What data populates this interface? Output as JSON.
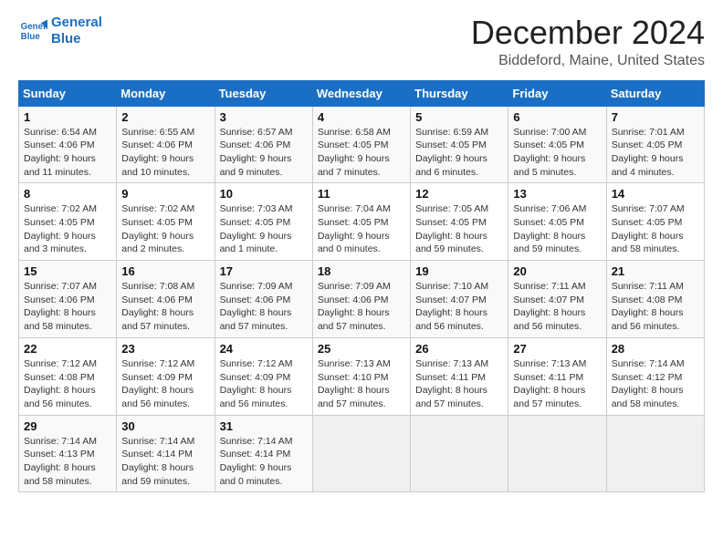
{
  "header": {
    "logo_line1": "General",
    "logo_line2": "Blue",
    "month": "December 2024",
    "location": "Biddeford, Maine, United States"
  },
  "weekdays": [
    "Sunday",
    "Monday",
    "Tuesday",
    "Wednesday",
    "Thursday",
    "Friday",
    "Saturday"
  ],
  "weeks": [
    [
      {
        "day": 1,
        "info": "Sunrise: 6:54 AM\nSunset: 4:06 PM\nDaylight: 9 hours\nand 11 minutes."
      },
      {
        "day": 2,
        "info": "Sunrise: 6:55 AM\nSunset: 4:06 PM\nDaylight: 9 hours\nand 10 minutes."
      },
      {
        "day": 3,
        "info": "Sunrise: 6:57 AM\nSunset: 4:06 PM\nDaylight: 9 hours\nand 9 minutes."
      },
      {
        "day": 4,
        "info": "Sunrise: 6:58 AM\nSunset: 4:05 PM\nDaylight: 9 hours\nand 7 minutes."
      },
      {
        "day": 5,
        "info": "Sunrise: 6:59 AM\nSunset: 4:05 PM\nDaylight: 9 hours\nand 6 minutes."
      },
      {
        "day": 6,
        "info": "Sunrise: 7:00 AM\nSunset: 4:05 PM\nDaylight: 9 hours\nand 5 minutes."
      },
      {
        "day": 7,
        "info": "Sunrise: 7:01 AM\nSunset: 4:05 PM\nDaylight: 9 hours\nand 4 minutes."
      }
    ],
    [
      {
        "day": 8,
        "info": "Sunrise: 7:02 AM\nSunset: 4:05 PM\nDaylight: 9 hours\nand 3 minutes."
      },
      {
        "day": 9,
        "info": "Sunrise: 7:02 AM\nSunset: 4:05 PM\nDaylight: 9 hours\nand 2 minutes."
      },
      {
        "day": 10,
        "info": "Sunrise: 7:03 AM\nSunset: 4:05 PM\nDaylight: 9 hours\nand 1 minute."
      },
      {
        "day": 11,
        "info": "Sunrise: 7:04 AM\nSunset: 4:05 PM\nDaylight: 9 hours\nand 0 minutes."
      },
      {
        "day": 12,
        "info": "Sunrise: 7:05 AM\nSunset: 4:05 PM\nDaylight: 8 hours\nand 59 minutes."
      },
      {
        "day": 13,
        "info": "Sunrise: 7:06 AM\nSunset: 4:05 PM\nDaylight: 8 hours\nand 59 minutes."
      },
      {
        "day": 14,
        "info": "Sunrise: 7:07 AM\nSunset: 4:05 PM\nDaylight: 8 hours\nand 58 minutes."
      }
    ],
    [
      {
        "day": 15,
        "info": "Sunrise: 7:07 AM\nSunset: 4:06 PM\nDaylight: 8 hours\nand 58 minutes."
      },
      {
        "day": 16,
        "info": "Sunrise: 7:08 AM\nSunset: 4:06 PM\nDaylight: 8 hours\nand 57 minutes."
      },
      {
        "day": 17,
        "info": "Sunrise: 7:09 AM\nSunset: 4:06 PM\nDaylight: 8 hours\nand 57 minutes."
      },
      {
        "day": 18,
        "info": "Sunrise: 7:09 AM\nSunset: 4:06 PM\nDaylight: 8 hours\nand 57 minutes."
      },
      {
        "day": 19,
        "info": "Sunrise: 7:10 AM\nSunset: 4:07 PM\nDaylight: 8 hours\nand 56 minutes."
      },
      {
        "day": 20,
        "info": "Sunrise: 7:11 AM\nSunset: 4:07 PM\nDaylight: 8 hours\nand 56 minutes."
      },
      {
        "day": 21,
        "info": "Sunrise: 7:11 AM\nSunset: 4:08 PM\nDaylight: 8 hours\nand 56 minutes."
      }
    ],
    [
      {
        "day": 22,
        "info": "Sunrise: 7:12 AM\nSunset: 4:08 PM\nDaylight: 8 hours\nand 56 minutes."
      },
      {
        "day": 23,
        "info": "Sunrise: 7:12 AM\nSunset: 4:09 PM\nDaylight: 8 hours\nand 56 minutes."
      },
      {
        "day": 24,
        "info": "Sunrise: 7:12 AM\nSunset: 4:09 PM\nDaylight: 8 hours\nand 56 minutes."
      },
      {
        "day": 25,
        "info": "Sunrise: 7:13 AM\nSunset: 4:10 PM\nDaylight: 8 hours\nand 57 minutes."
      },
      {
        "day": 26,
        "info": "Sunrise: 7:13 AM\nSunset: 4:11 PM\nDaylight: 8 hours\nand 57 minutes."
      },
      {
        "day": 27,
        "info": "Sunrise: 7:13 AM\nSunset: 4:11 PM\nDaylight: 8 hours\nand 57 minutes."
      },
      {
        "day": 28,
        "info": "Sunrise: 7:14 AM\nSunset: 4:12 PM\nDaylight: 8 hours\nand 58 minutes."
      }
    ],
    [
      {
        "day": 29,
        "info": "Sunrise: 7:14 AM\nSunset: 4:13 PM\nDaylight: 8 hours\nand 58 minutes."
      },
      {
        "day": 30,
        "info": "Sunrise: 7:14 AM\nSunset: 4:14 PM\nDaylight: 8 hours\nand 59 minutes."
      },
      {
        "day": 31,
        "info": "Sunrise: 7:14 AM\nSunset: 4:14 PM\nDaylight: 9 hours\nand 0 minutes."
      },
      null,
      null,
      null,
      null
    ]
  ]
}
